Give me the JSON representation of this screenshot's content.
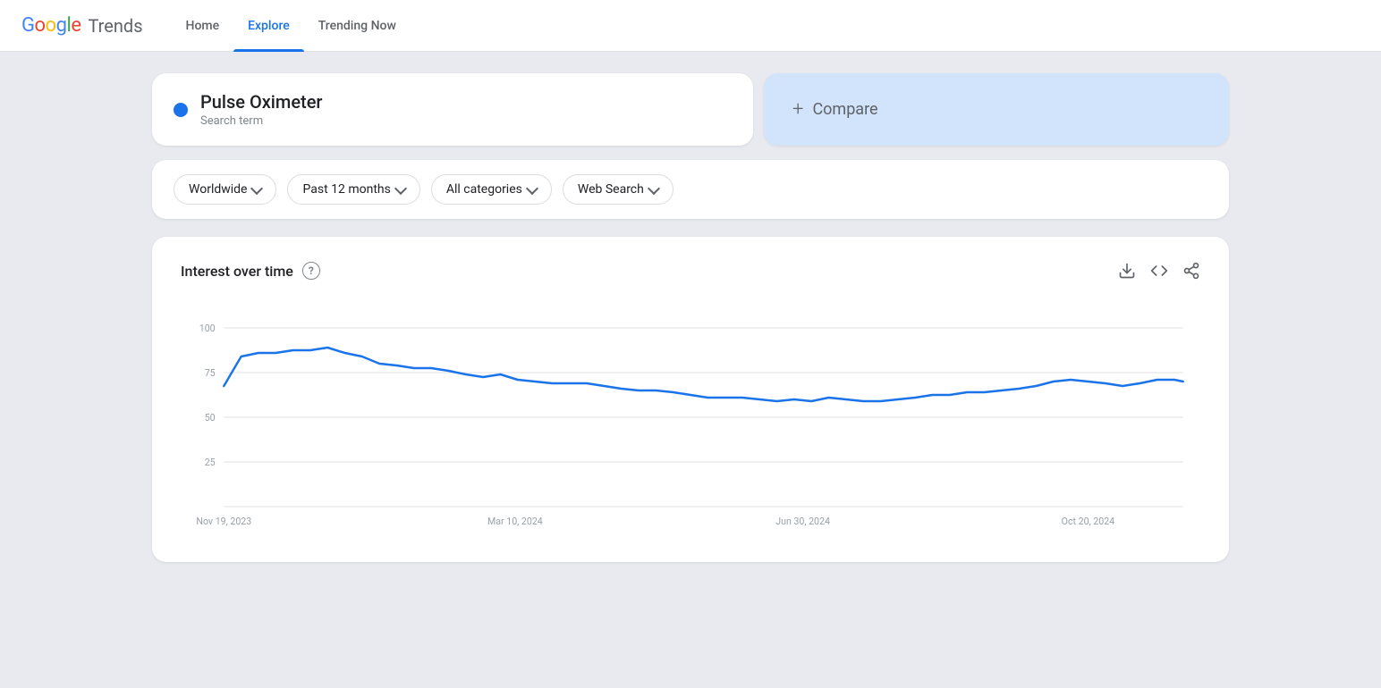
{
  "header": {
    "logo": {
      "google": "Google",
      "trends": "Trends"
    },
    "nav": [
      {
        "id": "home",
        "label": "Home",
        "active": false
      },
      {
        "id": "explore",
        "label": "Explore",
        "active": true
      },
      {
        "id": "trending-now",
        "label": "Trending Now",
        "active": false
      }
    ]
  },
  "search": {
    "term": "Pulse Oximeter",
    "type": "Search term",
    "dot_color": "#1a73e8"
  },
  "compare": {
    "label": "Compare",
    "plus": "+"
  },
  "filters": [
    {
      "id": "location",
      "label": "Worldwide"
    },
    {
      "id": "time",
      "label": "Past 12 months"
    },
    {
      "id": "category",
      "label": "All categories"
    },
    {
      "id": "search_type",
      "label": "Web Search"
    }
  ],
  "chart": {
    "title": "Interest over time",
    "help": "?",
    "y_labels": [
      "100",
      "75",
      "50",
      "25"
    ],
    "x_labels": [
      "Nov 19, 2023",
      "Mar 10, 2024",
      "Jun 30, 2024",
      "Oct 20, 2024"
    ],
    "actions": {
      "download": "↓",
      "embed": "<>",
      "share": "share"
    }
  }
}
